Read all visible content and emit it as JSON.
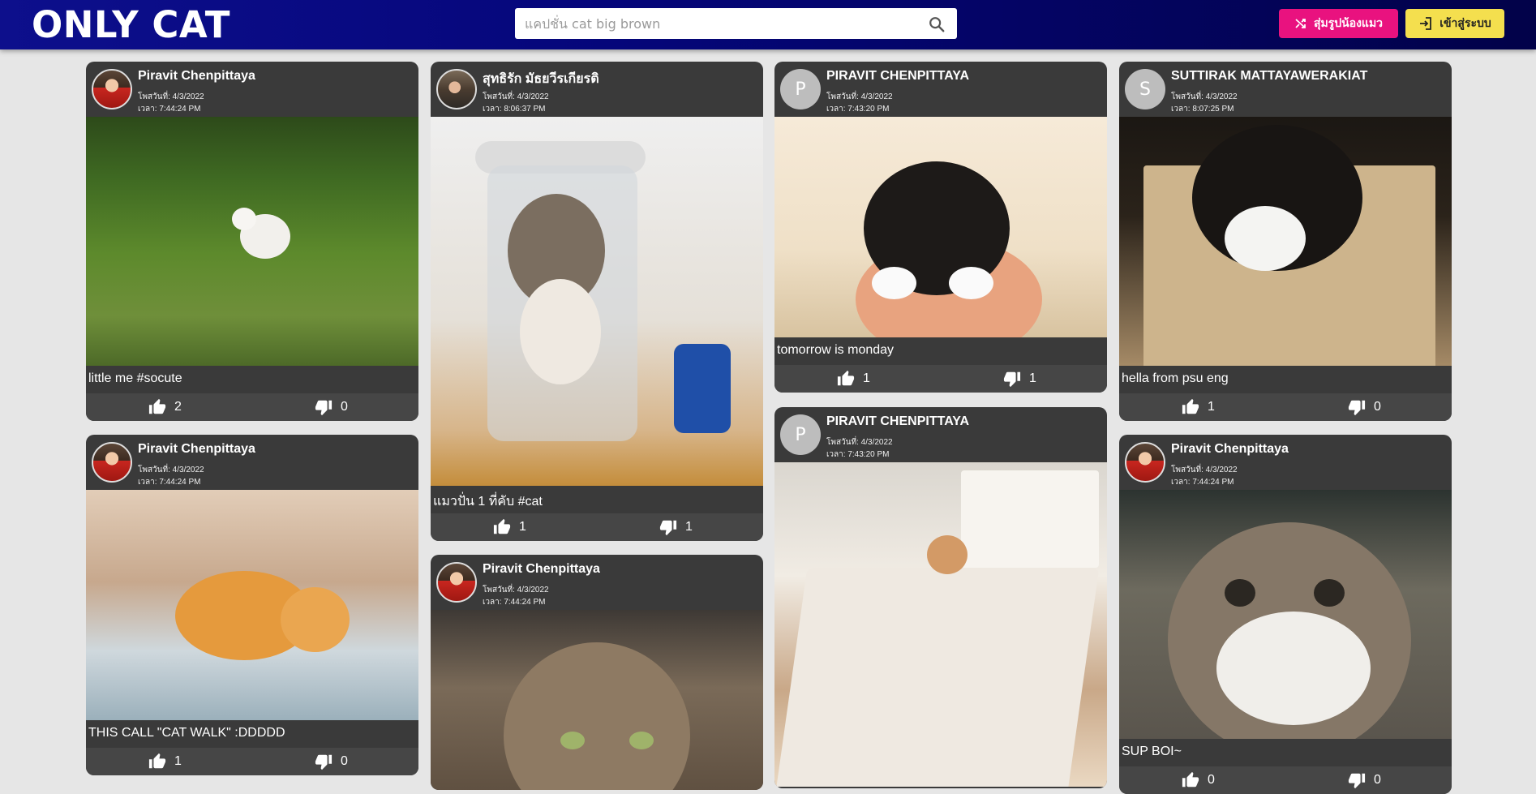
{
  "header": {
    "logo": "ONLY CAT",
    "search_placeholder": "แคปชั่น cat big brown",
    "random_button": "สุ่มรูปน้องแมว",
    "login_button": "เข้าสู่ระบบ"
  },
  "labels": {
    "date_prefix": "โพสวันที่: ",
    "time_prefix": "เวลา: "
  },
  "posts": [
    {
      "user": "Piravit Chenpittaya",
      "date": "โพสวันที่: 4/3/2022",
      "time": "เวลา: 7:44:24 PM",
      "caption": "little me #socute",
      "likes": "2",
      "dislikes": "0"
    },
    {
      "user": "Piravit Chenpittaya",
      "date": "โพสวันที่: 4/3/2022",
      "time": "เวลา: 7:44:24 PM",
      "caption": "THIS CALL \"CAT WALK\" :DDDDD",
      "likes": "1",
      "dislikes": "0"
    },
    {
      "user": "สุทธิรัก มัธยวีรเกียรติ",
      "date": "โพสวันที่: 4/3/2022",
      "time": "เวลา: 8:06:37 PM",
      "caption": "แมวปั่น 1 ที่คับ #cat",
      "likes": "1",
      "dislikes": "1"
    },
    {
      "user": "Piravit Chenpittaya",
      "date": "โพสวันที่: 4/3/2022",
      "time": "เวลา: 7:44:24 PM",
      "caption": "",
      "likes": "",
      "dislikes": ""
    },
    {
      "user": "PIRAVIT CHENPITTAYA",
      "avatar_letter": "P",
      "date": "โพสวันที่: 4/3/2022",
      "time": "เวลา: 7:43:20 PM",
      "caption": "tomorrow is monday",
      "likes": "1",
      "dislikes": "1"
    },
    {
      "user": "PIRAVIT CHENPITTAYA",
      "avatar_letter": "P",
      "date": "โพสวันที่: 4/3/2022",
      "time": "เวลา: 7:43:20 PM",
      "caption": "",
      "likes": "",
      "dislikes": ""
    },
    {
      "user": "SUTTIRAK MATTAYAWERAKIAT",
      "avatar_letter": "S",
      "date": "โพสวันที่: 4/3/2022",
      "time": "เวลา: 8:07:25 PM",
      "caption": "hella from psu eng",
      "likes": "1",
      "dislikes": "0"
    },
    {
      "user": "Piravit Chenpittaya",
      "date": "โพสวันที่: 4/3/2022",
      "time": "เวลา: 7:44:24 PM",
      "caption": "SUP BOI~",
      "likes": "0",
      "dislikes": "0"
    }
  ]
}
